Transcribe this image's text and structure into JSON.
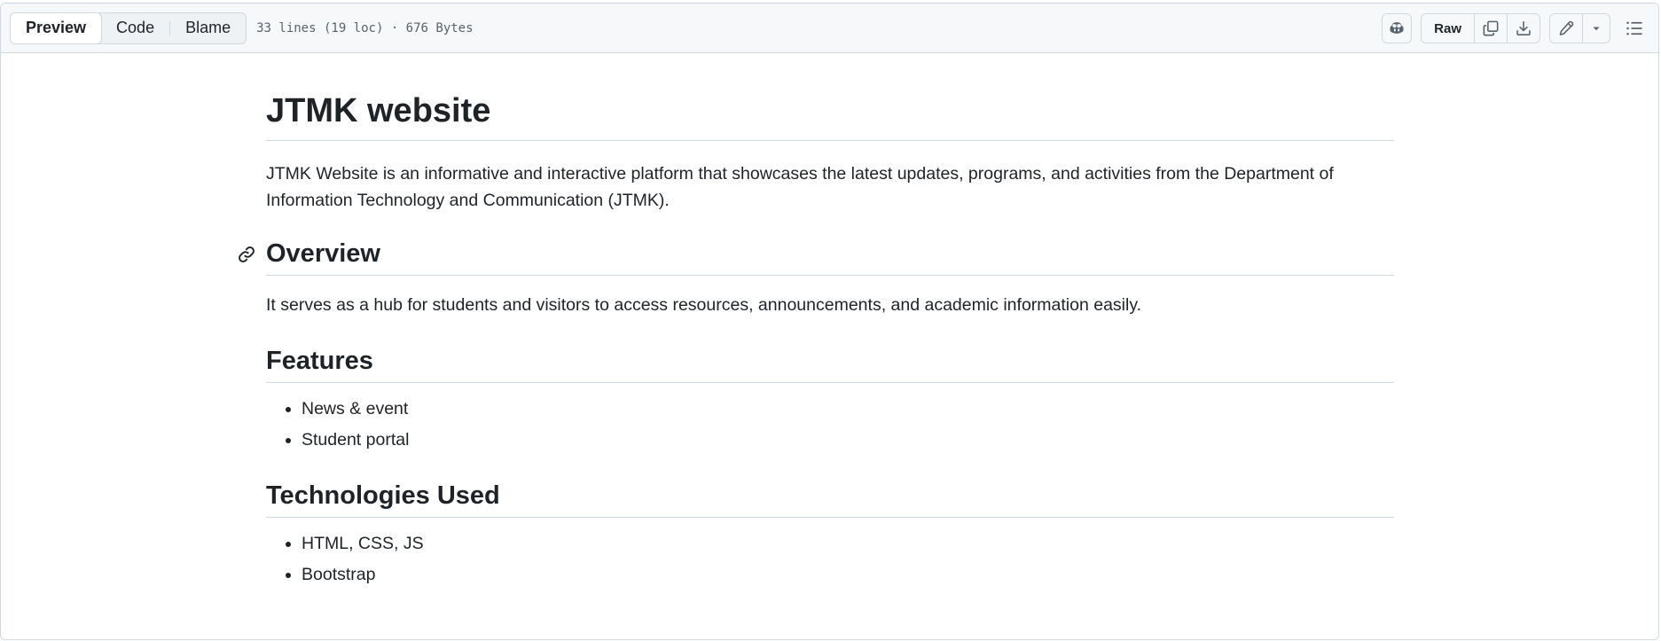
{
  "toolbar": {
    "tabs": [
      {
        "label": "Preview",
        "active": true
      },
      {
        "label": "Code",
        "active": false
      },
      {
        "label": "Blame",
        "active": false
      }
    ],
    "file_meta": "33 lines (19 loc) · 676 Bytes",
    "raw_label": "Raw",
    "icons": [
      "copilot-icon",
      "copy-icon",
      "download-icon",
      "pencil-icon",
      "triangle-down-icon",
      "list-unordered-icon"
    ]
  },
  "readme": {
    "title": "JTMK website",
    "intro": "JTMK Website is an informative and interactive platform that showcases the latest updates, programs, and activities from the Department of Information Technology and Communication (JTMK).",
    "overview_heading": "Overview",
    "overview_text": "It serves as a hub for students and visitors to access resources, announcements, and academic information easily.",
    "features_heading": "Features",
    "features": [
      "News & event",
      "Student portal"
    ],
    "tech_heading": "Technologies Used",
    "technologies": [
      "HTML, CSS, JS",
      "Bootstrap"
    ]
  },
  "colors": {
    "text": "#1f2328",
    "muted": "#59636e",
    "border": "#d1d9e0",
    "toolbar_bg": "#f6f8fa"
  }
}
